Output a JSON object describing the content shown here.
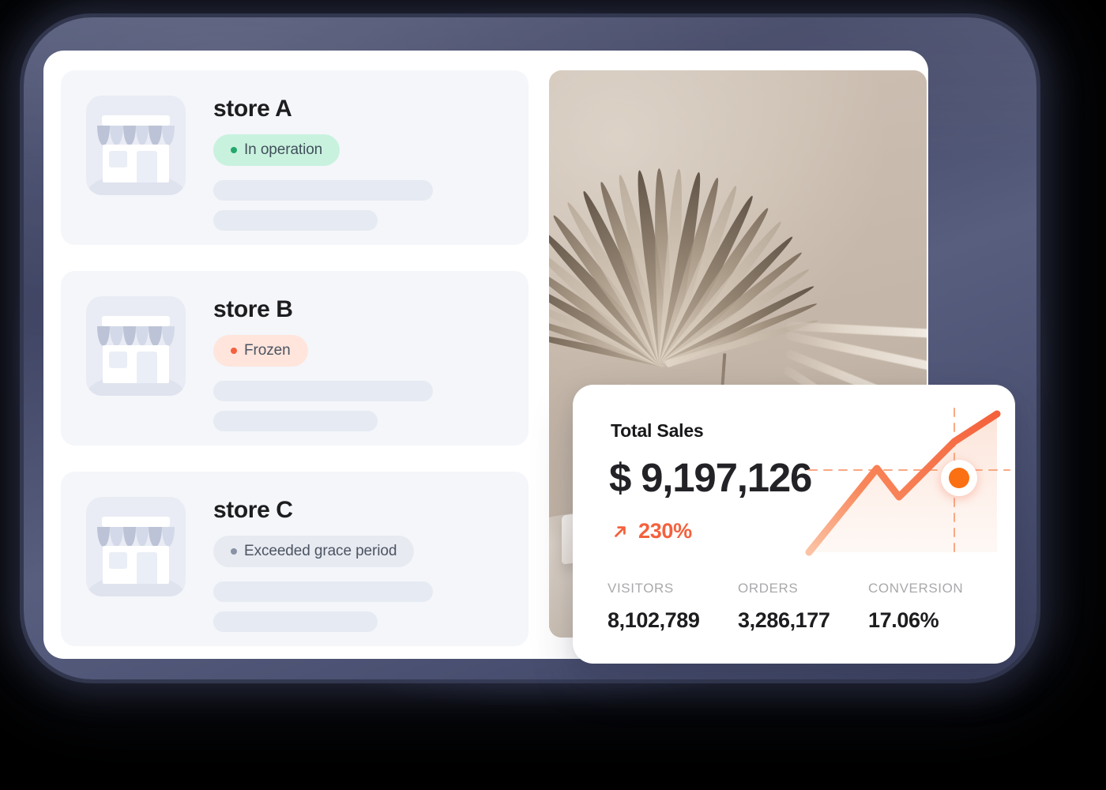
{
  "stores": [
    {
      "name": "store A",
      "status": "In operation",
      "status_tone": "green",
      "icon": "storefront-icon"
    },
    {
      "name": "store B",
      "status": "Frozen",
      "status_tone": "orange",
      "icon": "storefront-icon"
    },
    {
      "name": "store C",
      "status": "Exceeded grace period",
      "status_tone": "gray",
      "icon": "storefront-icon"
    }
  ],
  "sales_card": {
    "title": "Total Sales",
    "amount": "$ 9,197,126",
    "growth": "230%",
    "growth_arrow": "arrow-up-right-icon",
    "stats": [
      {
        "label": "VISITORS",
        "value": "8,102,789"
      },
      {
        "label": "ORDERS",
        "value": "3,286,177"
      },
      {
        "label": "CONVERSION",
        "value": "17.06%"
      }
    ]
  },
  "colors": {
    "accent_orange": "#f4613c",
    "marker_orange": "#fa7012",
    "status_green_bg": "#c9f2de",
    "status_green_dot": "#23a86b",
    "status_orange_bg": "#ffe5dc",
    "status_orange_dot": "#f4613c",
    "status_gray_bg": "#e7eaf1",
    "status_gray_dot": "#8a93a5",
    "card_bg": "#f4f6fa",
    "frame_slate": "#474e70"
  },
  "chart_data": {
    "type": "area",
    "title": "Total Sales",
    "x": [
      0,
      1,
      2,
      3,
      4,
      5
    ],
    "values": [
      4,
      38,
      62,
      42,
      78,
      96
    ],
    "xlabel": "",
    "ylabel": "",
    "ylim": [
      0,
      100
    ],
    "grid": false,
    "legend": "none",
    "marker_index": 4,
    "marker_label": "230%",
    "line_color": "#f4613c",
    "fill_color": "#fde7dd",
    "crosshair": true
  }
}
